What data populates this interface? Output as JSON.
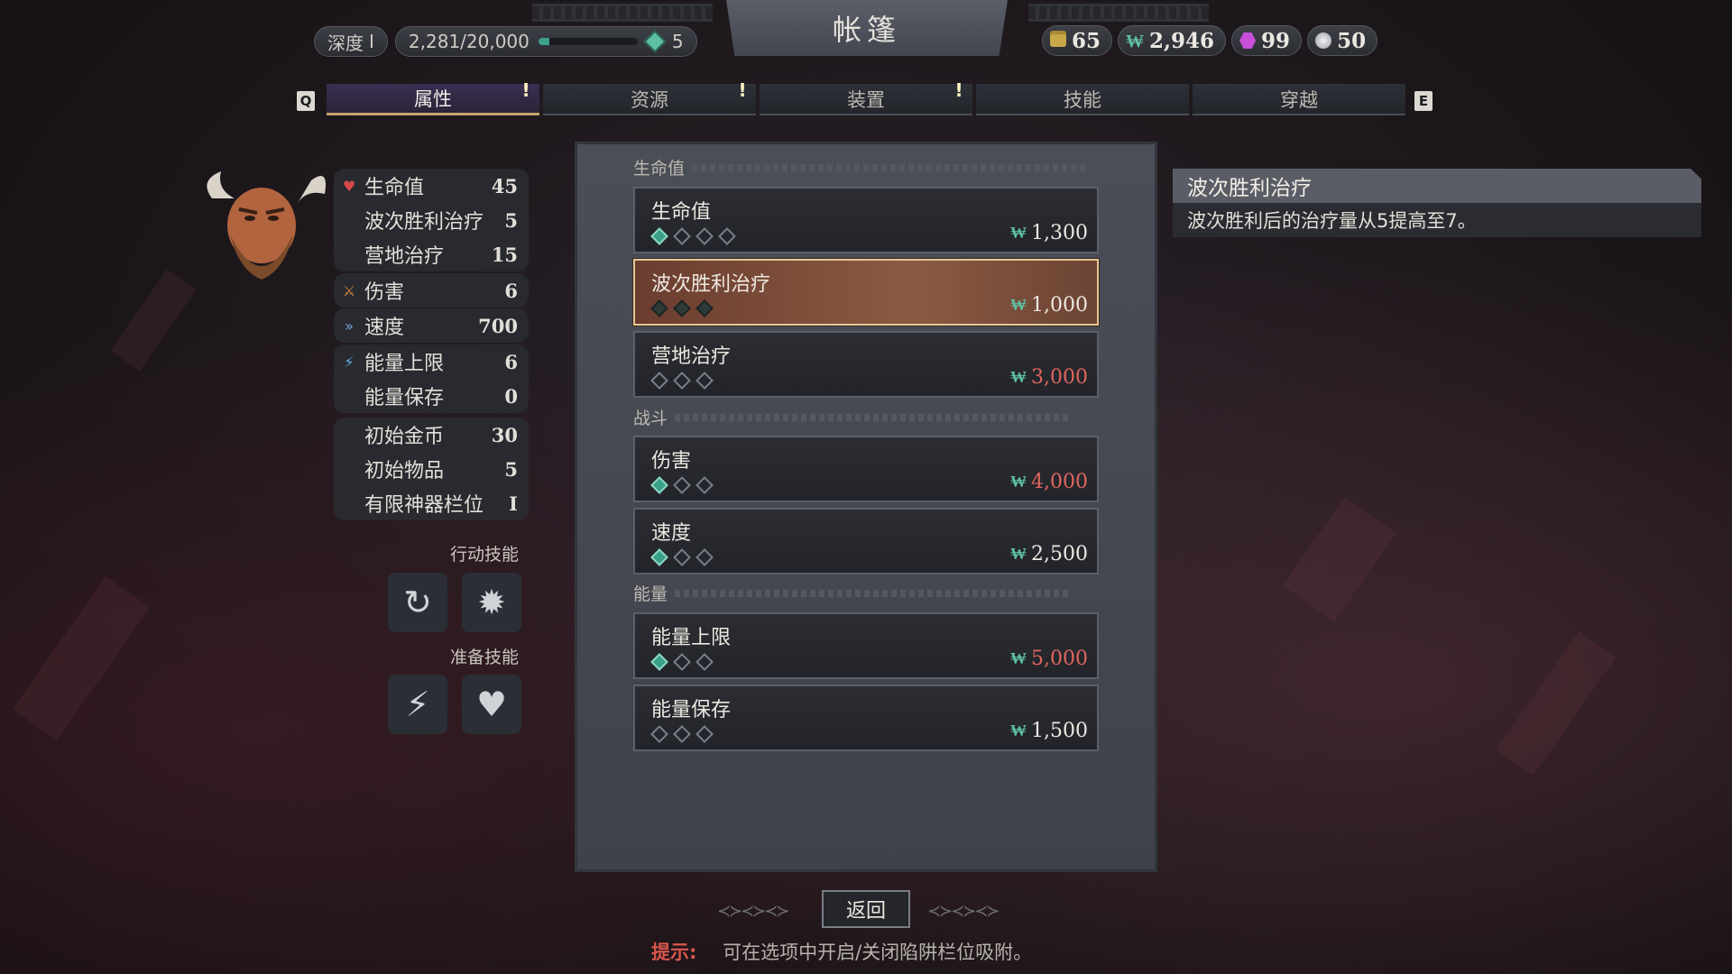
{
  "header": {
    "title": "帐篷",
    "depth_label": "深度",
    "depth_value": "I",
    "xp_text": "2,281/20,000",
    "xp_progress": 0.114,
    "level_value": "5",
    "currencies": [
      {
        "icon": "gold-coin-icon",
        "value": "65"
      },
      {
        "icon": "bill-icon",
        "value": "2,946"
      },
      {
        "icon": "purple-gem-icon",
        "value": "99"
      },
      {
        "icon": "orb-icon",
        "value": "50"
      }
    ]
  },
  "tabs": {
    "left_key": "Q",
    "right_key": "E",
    "items": [
      {
        "label": "属性",
        "active": true,
        "alert": "!"
      },
      {
        "label": "资源",
        "active": false,
        "alert": "!"
      },
      {
        "label": "装置",
        "active": false,
        "alert": "!"
      },
      {
        "label": "技能",
        "active": false
      },
      {
        "label": "穿越",
        "active": false
      }
    ]
  },
  "stats": {
    "health": [
      {
        "name": "生命值",
        "value": "45"
      },
      {
        "name": "波次胜利治疗",
        "value": "5"
      },
      {
        "name": "营地治疗",
        "value": "15"
      }
    ],
    "damage": {
      "name": "伤害",
      "value": "6"
    },
    "speed": {
      "name": "速度",
      "value": "700"
    },
    "energy": [
      {
        "name": "能量上限",
        "value": "6"
      },
      {
        "name": "能量保存",
        "value": "0"
      }
    ],
    "start": [
      {
        "name": "初始金币",
        "value": "30"
      },
      {
        "name": "初始物品",
        "value": "5"
      },
      {
        "name": "有限神器栏位",
        "value": "I"
      }
    ]
  },
  "skills": {
    "action_title": "行动技能",
    "prep_title": "准备技能"
  },
  "sections": {
    "health": "生命值",
    "combat": "战斗",
    "energy": "能量"
  },
  "upgrades": [
    {
      "name": "生命值",
      "cost": "1,300",
      "filled": 1,
      "total": 4,
      "affordable": true,
      "selected": false
    },
    {
      "name": "波次胜利治疗",
      "cost": "1,000",
      "filled": 3,
      "total": 3,
      "affordable": true,
      "selected": true
    },
    {
      "name": "营地治疗",
      "cost": "3,000",
      "filled": 0,
      "total": 3,
      "affordable": false,
      "selected": false
    },
    {
      "name": "伤害",
      "cost": "4,000",
      "filled": 1,
      "total": 3,
      "affordable": false,
      "selected": false
    },
    {
      "name": "速度",
      "cost": "2,500",
      "filled": 1,
      "total": 3,
      "affordable": true,
      "selected": false
    },
    {
      "name": "能量上限",
      "cost": "5,000",
      "filled": 1,
      "total": 3,
      "affordable": false,
      "selected": false
    },
    {
      "name": "能量保存",
      "cost": "1,500",
      "filled": 0,
      "total": 3,
      "affordable": true,
      "selected": false
    }
  ],
  "tooltip": {
    "title": "波次胜利治疗",
    "body": "波次胜利后的治疗量从5提高至7。"
  },
  "footer": {
    "back_label": "返回",
    "hint_label": "提示:",
    "hint_text": "可在选项中开启/关闭陷阱栏位吸附。"
  },
  "colors": {
    "accent_teal": "#5fbfa4",
    "cost_unaffordable": "#e0665d",
    "selected_bg": "#8b5a43",
    "active_tab": "#3a2f52"
  }
}
